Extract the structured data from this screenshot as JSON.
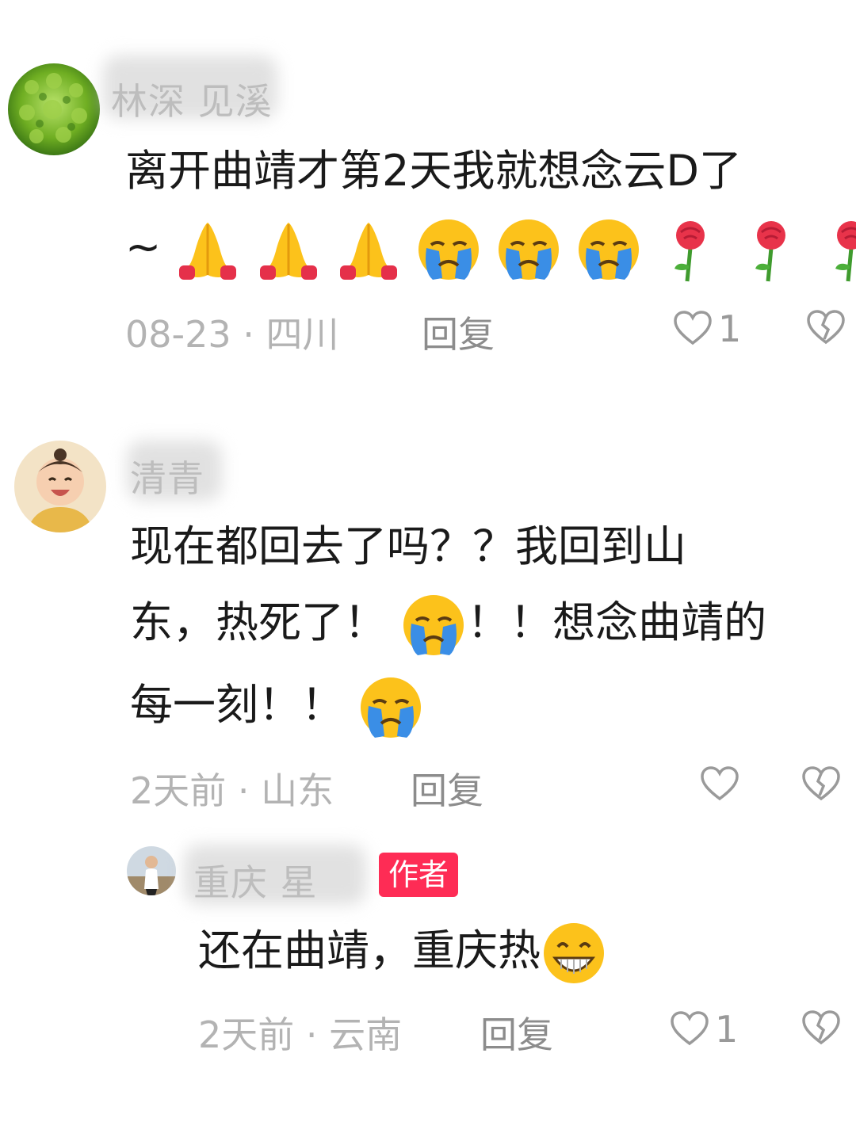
{
  "comments": [
    {
      "username": "林深 见溪",
      "text_line1": "离开曲靖才第2天我就想念云D了",
      "text_line2_prefix": "~",
      "meta": "08-23 · 四川",
      "reply_label": "回复",
      "like_count": "1"
    },
    {
      "username": "清青",
      "text_line1": "现在都回去了吗？？我回到山",
      "text_line2_a": "东，热死了！",
      "text_line2_b": "！！想念曲靖的",
      "text_line3": "每一刻！！",
      "meta": "2天前 · 山东",
      "reply_label": "回复",
      "like_count": ""
    },
    {
      "username": "重庆 星",
      "badge": "作者",
      "text": "还在曲靖，重庆热",
      "meta": "2天前 · 云南",
      "reply_label": "回复",
      "like_count": "1"
    }
  ],
  "icons": {
    "pray": "folded-hands",
    "cry": "loudly-crying-face",
    "rose": "rose",
    "grin": "grinning-face",
    "like": "heart-outline-icon",
    "dislike": "broken-heart-icon"
  },
  "colors": {
    "badge": "#fe2c55",
    "meta": "#b3b3b3",
    "username": "#bdbdbd"
  }
}
